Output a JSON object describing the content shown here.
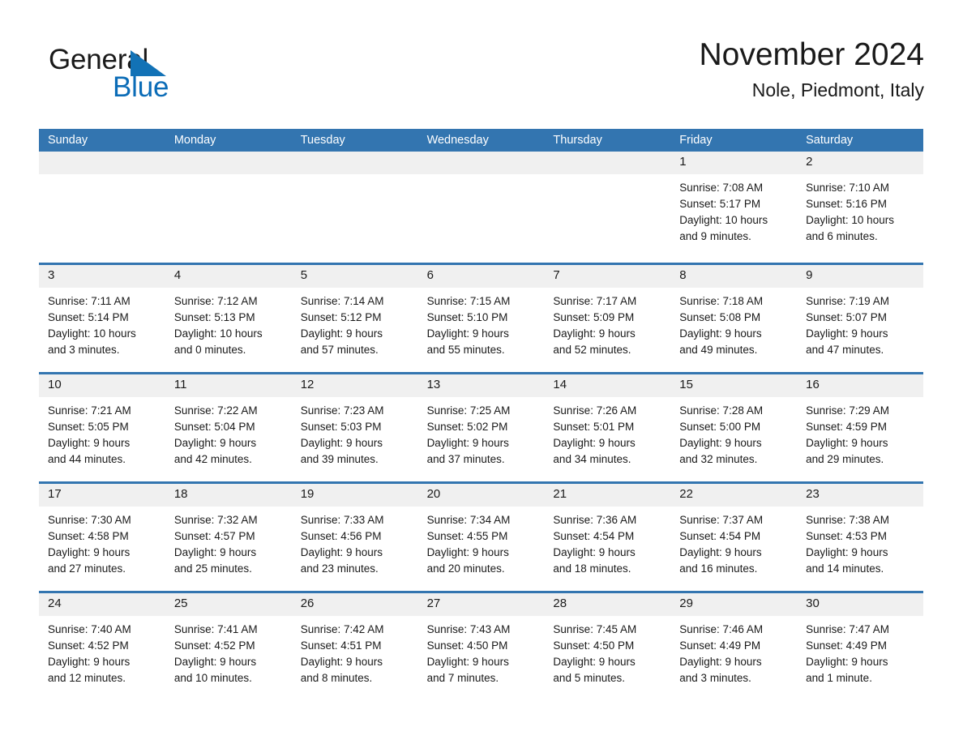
{
  "brand": {
    "name_part1": "General",
    "name_part2": "Blue",
    "logo_icon": "blue-triangle-icon",
    "accent_color": "#0b6cb7"
  },
  "header": {
    "title": "November 2024",
    "location": "Nole, Piedmont, Italy"
  },
  "theme": {
    "header_blue": "#3375b0",
    "daynum_band": "#f0f0f0",
    "text": "#1a1a1a"
  },
  "calendar": {
    "weekdays": [
      "Sunday",
      "Monday",
      "Tuesday",
      "Wednesday",
      "Thursday",
      "Friday",
      "Saturday"
    ],
    "weeks": [
      [
        {
          "day": "",
          "lines": []
        },
        {
          "day": "",
          "lines": []
        },
        {
          "day": "",
          "lines": []
        },
        {
          "day": "",
          "lines": []
        },
        {
          "day": "",
          "lines": []
        },
        {
          "day": "1",
          "lines": [
            "Sunrise: 7:08 AM",
            "Sunset: 5:17 PM",
            "Daylight: 10 hours",
            "and 9 minutes."
          ]
        },
        {
          "day": "2",
          "lines": [
            "Sunrise: 7:10 AM",
            "Sunset: 5:16 PM",
            "Daylight: 10 hours",
            "and 6 minutes."
          ]
        }
      ],
      [
        {
          "day": "3",
          "lines": [
            "Sunrise: 7:11 AM",
            "Sunset: 5:14 PM",
            "Daylight: 10 hours",
            "and 3 minutes."
          ]
        },
        {
          "day": "4",
          "lines": [
            "Sunrise: 7:12 AM",
            "Sunset: 5:13 PM",
            "Daylight: 10 hours",
            "and 0 minutes."
          ]
        },
        {
          "day": "5",
          "lines": [
            "Sunrise: 7:14 AM",
            "Sunset: 5:12 PM",
            "Daylight: 9 hours",
            "and 57 minutes."
          ]
        },
        {
          "day": "6",
          "lines": [
            "Sunrise: 7:15 AM",
            "Sunset: 5:10 PM",
            "Daylight: 9 hours",
            "and 55 minutes."
          ]
        },
        {
          "day": "7",
          "lines": [
            "Sunrise: 7:17 AM",
            "Sunset: 5:09 PM",
            "Daylight: 9 hours",
            "and 52 minutes."
          ]
        },
        {
          "day": "8",
          "lines": [
            "Sunrise: 7:18 AM",
            "Sunset: 5:08 PM",
            "Daylight: 9 hours",
            "and 49 minutes."
          ]
        },
        {
          "day": "9",
          "lines": [
            "Sunrise: 7:19 AM",
            "Sunset: 5:07 PM",
            "Daylight: 9 hours",
            "and 47 minutes."
          ]
        }
      ],
      [
        {
          "day": "10",
          "lines": [
            "Sunrise: 7:21 AM",
            "Sunset: 5:05 PM",
            "Daylight: 9 hours",
            "and 44 minutes."
          ]
        },
        {
          "day": "11",
          "lines": [
            "Sunrise: 7:22 AM",
            "Sunset: 5:04 PM",
            "Daylight: 9 hours",
            "and 42 minutes."
          ]
        },
        {
          "day": "12",
          "lines": [
            "Sunrise: 7:23 AM",
            "Sunset: 5:03 PM",
            "Daylight: 9 hours",
            "and 39 minutes."
          ]
        },
        {
          "day": "13",
          "lines": [
            "Sunrise: 7:25 AM",
            "Sunset: 5:02 PM",
            "Daylight: 9 hours",
            "and 37 minutes."
          ]
        },
        {
          "day": "14",
          "lines": [
            "Sunrise: 7:26 AM",
            "Sunset: 5:01 PM",
            "Daylight: 9 hours",
            "and 34 minutes."
          ]
        },
        {
          "day": "15",
          "lines": [
            "Sunrise: 7:28 AM",
            "Sunset: 5:00 PM",
            "Daylight: 9 hours",
            "and 32 minutes."
          ]
        },
        {
          "day": "16",
          "lines": [
            "Sunrise: 7:29 AM",
            "Sunset: 4:59 PM",
            "Daylight: 9 hours",
            "and 29 minutes."
          ]
        }
      ],
      [
        {
          "day": "17",
          "lines": [
            "Sunrise: 7:30 AM",
            "Sunset: 4:58 PM",
            "Daylight: 9 hours",
            "and 27 minutes."
          ]
        },
        {
          "day": "18",
          "lines": [
            "Sunrise: 7:32 AM",
            "Sunset: 4:57 PM",
            "Daylight: 9 hours",
            "and 25 minutes."
          ]
        },
        {
          "day": "19",
          "lines": [
            "Sunrise: 7:33 AM",
            "Sunset: 4:56 PM",
            "Daylight: 9 hours",
            "and 23 minutes."
          ]
        },
        {
          "day": "20",
          "lines": [
            "Sunrise: 7:34 AM",
            "Sunset: 4:55 PM",
            "Daylight: 9 hours",
            "and 20 minutes."
          ]
        },
        {
          "day": "21",
          "lines": [
            "Sunrise: 7:36 AM",
            "Sunset: 4:54 PM",
            "Daylight: 9 hours",
            "and 18 minutes."
          ]
        },
        {
          "day": "22",
          "lines": [
            "Sunrise: 7:37 AM",
            "Sunset: 4:54 PM",
            "Daylight: 9 hours",
            "and 16 minutes."
          ]
        },
        {
          "day": "23",
          "lines": [
            "Sunrise: 7:38 AM",
            "Sunset: 4:53 PM",
            "Daylight: 9 hours",
            "and 14 minutes."
          ]
        }
      ],
      [
        {
          "day": "24",
          "lines": [
            "Sunrise: 7:40 AM",
            "Sunset: 4:52 PM",
            "Daylight: 9 hours",
            "and 12 minutes."
          ]
        },
        {
          "day": "25",
          "lines": [
            "Sunrise: 7:41 AM",
            "Sunset: 4:52 PM",
            "Daylight: 9 hours",
            "and 10 minutes."
          ]
        },
        {
          "day": "26",
          "lines": [
            "Sunrise: 7:42 AM",
            "Sunset: 4:51 PM",
            "Daylight: 9 hours",
            "and 8 minutes."
          ]
        },
        {
          "day": "27",
          "lines": [
            "Sunrise: 7:43 AM",
            "Sunset: 4:50 PM",
            "Daylight: 9 hours",
            "and 7 minutes."
          ]
        },
        {
          "day": "28",
          "lines": [
            "Sunrise: 7:45 AM",
            "Sunset: 4:50 PM",
            "Daylight: 9 hours",
            "and 5 minutes."
          ]
        },
        {
          "day": "29",
          "lines": [
            "Sunrise: 7:46 AM",
            "Sunset: 4:49 PM",
            "Daylight: 9 hours",
            "and 3 minutes."
          ]
        },
        {
          "day": "30",
          "lines": [
            "Sunrise: 7:47 AM",
            "Sunset: 4:49 PM",
            "Daylight: 9 hours",
            "and 1 minute."
          ]
        }
      ]
    ]
  }
}
